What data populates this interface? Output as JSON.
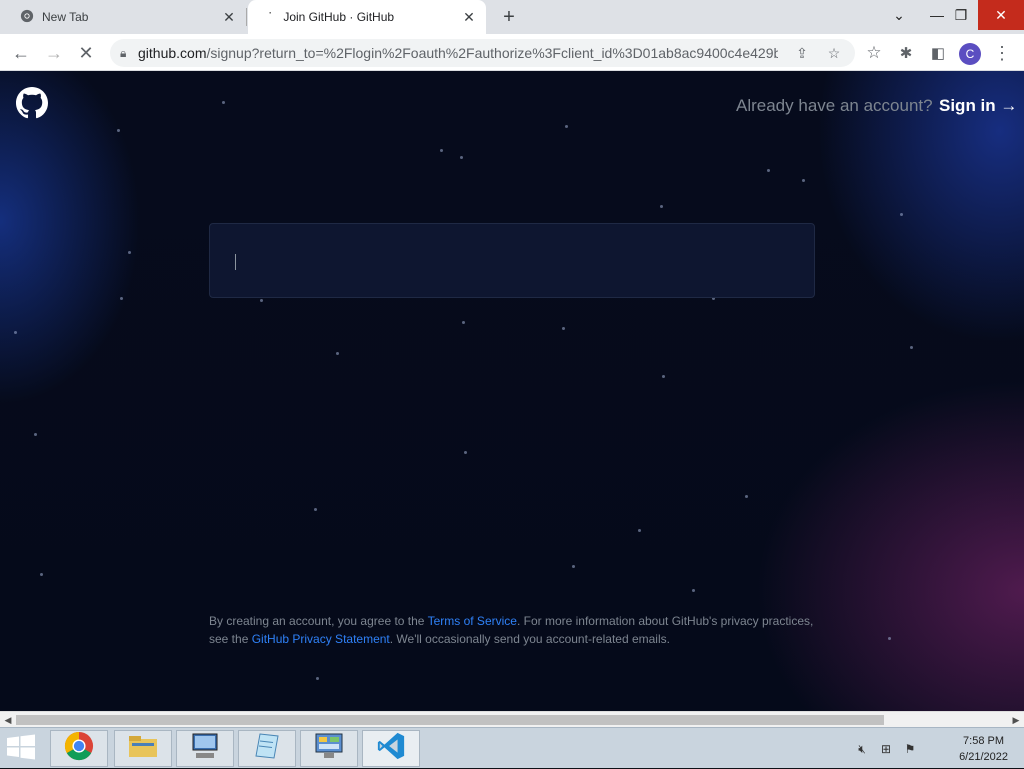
{
  "browser": {
    "tabs": [
      {
        "title": "New Tab",
        "active": false
      },
      {
        "title": "Join GitHub · GitHub",
        "active": true
      }
    ],
    "address": {
      "domain": "github.com",
      "path": "/signup?return_to=%2Flogin%2Foauth%2Fauthorize%3Fclient_id%3D01ab8ac9400c4e429b..."
    },
    "profile_initial": "C"
  },
  "page": {
    "header": {
      "already_text": "Already have an account?",
      "signin_label": "Sign in →"
    },
    "signup_input": {
      "value": ""
    },
    "legal": {
      "part1": "By creating an account, you agree to the ",
      "terms_link": "Terms of Service",
      "part2": ". For more information about GitHub's privacy practices, see the ",
      "privacy_link": "GitHub Privacy Statement",
      "part3": ". We'll occasionally send you account-related emails."
    }
  },
  "taskbar": {
    "apps": [
      "chrome-icon",
      "file-explorer-icon",
      "remote-desktop-icon",
      "notepad-icon",
      "control-panel-icon",
      "vscode-icon"
    ],
    "clock": {
      "time": "7:58 PM",
      "date": "6/21/2022"
    }
  },
  "colors": {
    "page_bg": "#050a1a",
    "link": "#2f81f7",
    "muted_text": "#7d8590"
  }
}
